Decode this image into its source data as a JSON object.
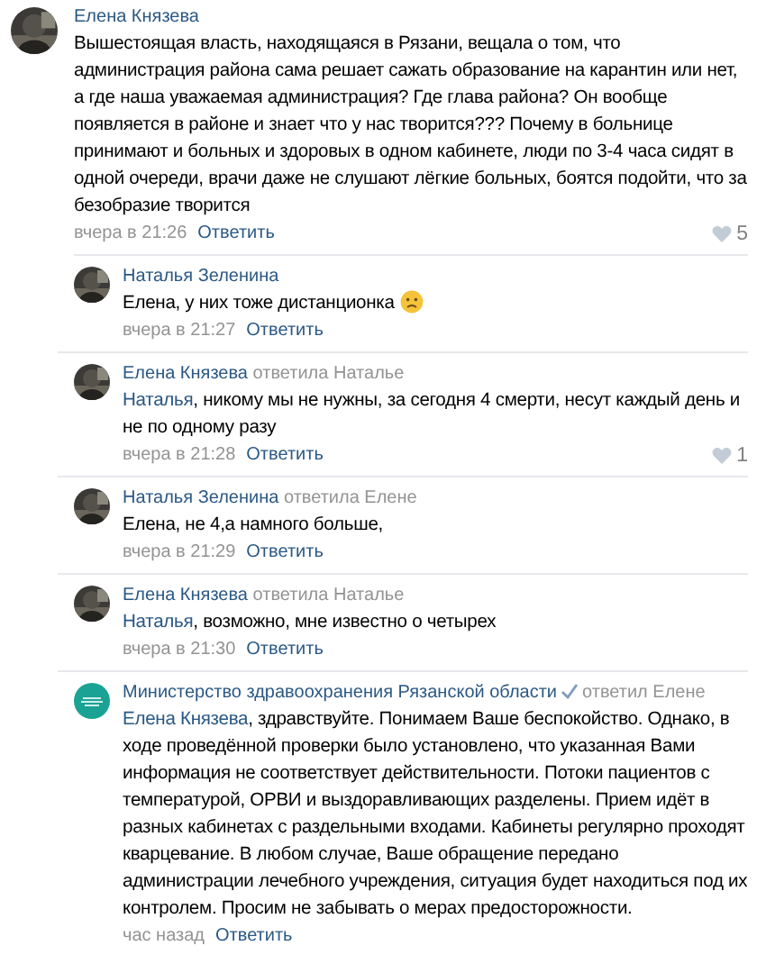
{
  "comments": [
    {
      "author": "Елена Князева",
      "text": "Вышестоящая власть, находящаяся в Рязани, вещала о том, что администрация района сама решает сажать образование на карантин или нет, а где наша уважаемая администрация? Где глава района? Он вообще появляется в районе и знает что у нас творится??? Почему в больнице принимают и больных и здоровых в одном кабинете, люди по 3-4 часа сидят в одной очереди, врачи даже не слушают лёгкие больных, боятся подойти, что за безобразие творится",
      "time": "вчера в 21:26",
      "reply_label": "Ответить",
      "likes": "5",
      "replies": [
        {
          "author": "Наталья Зеленина",
          "text": "Елена, у них тоже дистанционка",
          "emoji": {
            "kind": "sad"
          },
          "time": "вчера в 21:27",
          "reply_label": "Ответить"
        },
        {
          "author": "Елена Князева",
          "reply_to": "ответила Наталье",
          "addressee": "Наталья",
          "text": ", никому мы не нужны, за сегодня 4 смерти, несут каждый день и не по одному разу",
          "time": "вчера в 21:28",
          "reply_label": "Ответить",
          "likes": "1"
        },
        {
          "author": "Наталья Зеленина",
          "reply_to": "ответила Елене",
          "text": "Елена, не 4,а намного больше,",
          "time": "вчера в 21:29",
          "reply_label": "Ответить"
        },
        {
          "author": "Елена Князева",
          "reply_to": "ответила Наталье",
          "addressee": "Наталья",
          "text": ", возможно, мне известно о четырех",
          "time": "вчера в 21:30",
          "reply_label": "Ответить"
        },
        {
          "author": "Министерство здравоохранения Рязанской области",
          "verified": true,
          "reply_to": "ответил Елене",
          "avatar": {
            "kind": "logo"
          },
          "addressee": "Елена Князева",
          "text": ", здравствуйте. Понимаем Ваше беспокойство. Однако, в ходе проведённой проверки было установлено, что указанная Вами информация не соответствует действительности. Потоки пациентов с температурой, ОРВИ и выздоравливающих разделены. Прием идёт в разных кабинетах с раздельными входами. Кабинеты регулярно проходят кварцевание. В любом случае, Ваше обращение передано администрации лечебного учреждения, ситуация будет находиться под их контролем. Просим не забывать о мерах предосторожности.",
          "time": "час назад",
          "reply_label": "Ответить"
        }
      ]
    }
  ]
}
